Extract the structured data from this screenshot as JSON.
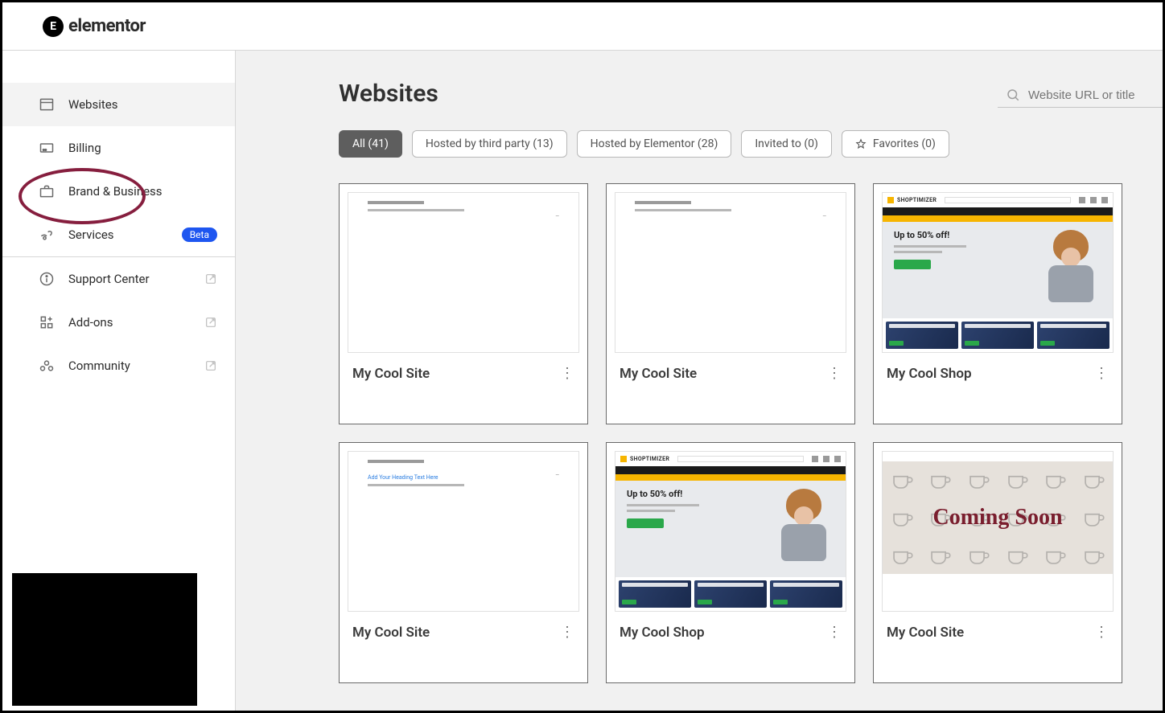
{
  "logo": {
    "mark": "E",
    "word": "elementor"
  },
  "sidebar": {
    "items": [
      {
        "label": "Websites"
      },
      {
        "label": "Billing"
      },
      {
        "label": "Brand & Business"
      },
      {
        "label": "Services",
        "badge": "Beta"
      },
      {
        "label": "Support Center"
      },
      {
        "label": "Add-ons"
      },
      {
        "label": "Community"
      }
    ]
  },
  "page": {
    "title": "Websites"
  },
  "search": {
    "placeholder": "Website URL or title"
  },
  "filters": [
    {
      "label": "All (41)",
      "active": true
    },
    {
      "label": "Hosted by third party (13)"
    },
    {
      "label": "Hosted by Elementor (28)"
    },
    {
      "label": "Invited to (0)"
    },
    {
      "label": "Favorites (0)",
      "icon": "star"
    }
  ],
  "shop": {
    "brand": "SHOPTIMIZER",
    "headline": "Up to 50% off!"
  },
  "coming": {
    "text": "Coming Soon"
  },
  "thumb_text": {
    "blue_line": "Add Your Heading Text Here"
  },
  "cards": [
    {
      "title": "My Cool Site",
      "type": "plain"
    },
    {
      "title": "My Cool Site",
      "type": "plain"
    },
    {
      "title": "My Cool Shop",
      "type": "shop"
    },
    {
      "title": "My Cool Site",
      "type": "blue"
    },
    {
      "title": "My Cool Shop",
      "type": "shop2"
    },
    {
      "title": "My Cool Site",
      "type": "coming"
    }
  ]
}
